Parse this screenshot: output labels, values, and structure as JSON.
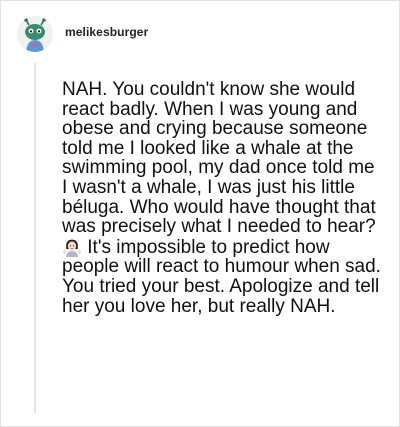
{
  "post": {
    "username": "melikesburger",
    "avatar_icon": "alien-avatar-icon",
    "comment_part1": "NAH. You couldn't know she would react badly. When I was young and obese and crying because someone told me I looked like a whale at the swimming pool, my dad once told me I wasn't a whale, I was just his little béluga. Who would have thought that was precisely what I needed to hear?",
    "emoji_icon": "person-shrugging-emoji",
    "comment_part2": "It's impossible to predict how people will react to humour when sad. You tried your best. Apologize and tell her you love her, but really NAH."
  }
}
